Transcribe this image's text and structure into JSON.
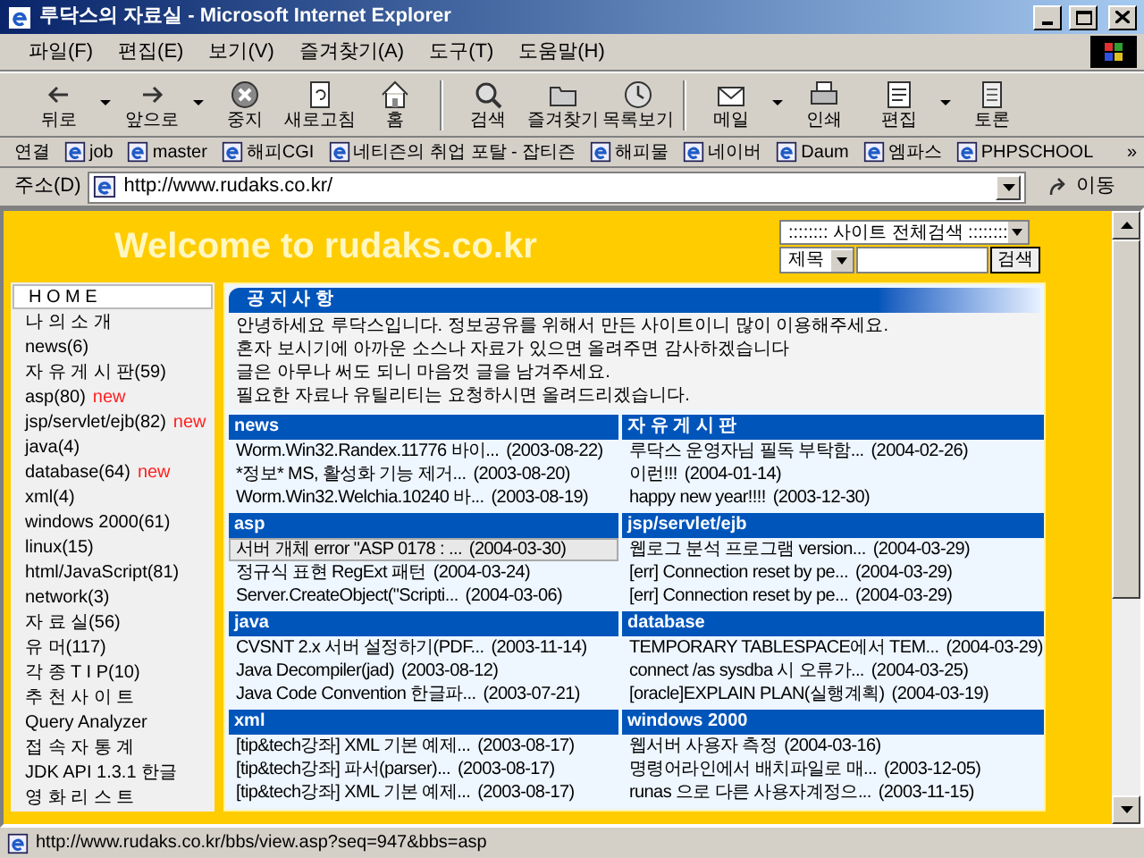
{
  "window": {
    "title": "루닥스의 자료실 - Microsoft Internet Explorer"
  },
  "menu": [
    "파일(F)",
    "편집(E)",
    "보기(V)",
    "즐겨찾기(A)",
    "도구(T)",
    "도움말(H)"
  ],
  "toolbar": [
    {
      "label": "뒤로",
      "dropdown": true
    },
    {
      "label": "앞으로",
      "dropdown": true
    },
    {
      "label": "중지",
      "dropdown": false
    },
    {
      "label": "새로고침",
      "dropdown": false
    },
    {
      "label": "홈",
      "dropdown": false
    },
    {
      "label": "검색",
      "dropdown": false
    },
    {
      "label": "즐겨찾기",
      "dropdown": false
    },
    {
      "label": "목록보기",
      "dropdown": false
    },
    {
      "label": "메일",
      "dropdown": true
    },
    {
      "label": "인쇄",
      "dropdown": false
    },
    {
      "label": "편집",
      "dropdown": true
    },
    {
      "label": "토론",
      "dropdown": false
    }
  ],
  "links_bar": {
    "label": "연결",
    "items": [
      "job",
      "master",
      "해피CGI",
      "네티즌의 취업 포탈 - 잡티즌",
      "해피물",
      "네이버",
      "Daum",
      "엠파스",
      "PHPSCHOOL"
    ],
    "more": "»"
  },
  "address_bar": {
    "label": "주소(D)",
    "url": "http://www.rudaks.co.kr/",
    "go": "이동"
  },
  "page": {
    "site_title": "Welcome to rudaks.co.kr",
    "search": {
      "scope": ":::::::: 사이트 전체검색 ::::::::",
      "field": "제목",
      "button": "검색"
    },
    "sidebar": [
      {
        "label": "H O M E",
        "selected": true
      },
      {
        "label": "나 의 소 개",
        "selected": false
      },
      {
        "label": "news(6)",
        "selected": false
      },
      {
        "label": "자 유 게 시 판(59)",
        "selected": false
      },
      {
        "label": "asp(80)",
        "badge": "new",
        "selected": false
      },
      {
        "label": "jsp/servlet/ejb(82)",
        "badge": "new",
        "selected": false
      },
      {
        "label": "java(4)",
        "selected": false
      },
      {
        "label": "database(64)",
        "badge": "new",
        "selected": false
      },
      {
        "label": "xml(4)",
        "selected": false
      },
      {
        "label": "windows 2000(61)",
        "selected": false
      },
      {
        "label": "linux(15)",
        "selected": false
      },
      {
        "label": "html/JavaScript(81)",
        "selected": false
      },
      {
        "label": "network(3)",
        "selected": false
      },
      {
        "label": "자 료 실(56)",
        "selected": false
      },
      {
        "label": "유 머(117)",
        "selected": false
      },
      {
        "label": "각 종 T I P(10)",
        "selected": false
      },
      {
        "label": "추 천 사 이 트",
        "selected": false
      },
      {
        "label": "Query Analyzer",
        "selected": false
      },
      {
        "label": "접 속 자 통 계",
        "selected": false
      },
      {
        "label": "JDK API 1.3.1 한글",
        "selected": false
      },
      {
        "label": "영 화 리 스 트",
        "selected": false
      }
    ],
    "notice": {
      "title": "공 지 사 항",
      "lines": [
        "안녕하세요 루닥스입니다. 정보공유를 위해서 만든 사이트이니 많이 이용해주세요.",
        "혼자 보시기에 아까운 소스나 자료가 있으면 올려주면 감사하겠습니다",
        "글은 아무나 써도 되니 마음껏 글을 남겨주세요.",
        "필요한 자료나 유틸리티는 요청하시면 올려드리겠습니다."
      ]
    },
    "boards": [
      {
        "title": "news",
        "posts": [
          {
            "title": "Worm.Win32.Randex.11776 바이...",
            "date": "(2003-08-22)",
            "hovered": false
          },
          {
            "title": "*정보* MS, 활성화 기능 제거...",
            "date": "(2003-08-20)",
            "hovered": false
          },
          {
            "title": "Worm.Win32.Welchia.10240 바...",
            "date": "(2003-08-19)",
            "hovered": false
          }
        ]
      },
      {
        "title": "자 유 게 시 판",
        "posts": [
          {
            "title": "루닥스 운영자님 필독 부탁함...",
            "date": "(2004-02-26)",
            "hovered": false
          },
          {
            "title": "이런!!!",
            "date": "(2004-01-14)",
            "hovered": false
          },
          {
            "title": "happy new year!!!!",
            "date": "(2003-12-30)",
            "hovered": false
          }
        ]
      },
      {
        "title": "asp",
        "posts": [
          {
            "title": "서버 개체 error \"ASP 0178 : ...",
            "date": "(2004-03-30)",
            "hovered": true
          },
          {
            "title": "정규식 표현 RegExt 패턴",
            "date": "(2004-03-24)",
            "hovered": false
          },
          {
            "title": "Server.CreateObject(\"Scripti...",
            "date": "(2004-03-06)",
            "hovered": false
          }
        ]
      },
      {
        "title": "jsp/servlet/ejb",
        "posts": [
          {
            "title": "웹로그 분석 프로그램 version...",
            "date": "(2004-03-29)",
            "hovered": false
          },
          {
            "title": "[err] Connection reset by pe...",
            "date": "(2004-03-29)",
            "hovered": false
          },
          {
            "title": "[err] Connection reset by pe...",
            "date": "(2004-03-29)",
            "hovered": false
          }
        ]
      },
      {
        "title": "java",
        "posts": [
          {
            "title": "CVSNT 2.x 서버 설정하기(PDF...",
            "date": "(2003-11-14)",
            "hovered": false
          },
          {
            "title": "Java Decompiler(jad)",
            "date": "(2003-08-12)",
            "hovered": false
          },
          {
            "title": "Java Code Convention 한글파...",
            "date": "(2003-07-21)",
            "hovered": false
          }
        ]
      },
      {
        "title": "database",
        "posts": [
          {
            "title": "TEMPORARY TABLESPACE에서 TEM...",
            "date": "(2004-03-29)",
            "hovered": false
          },
          {
            "title": "connect /as sysdba 시 오류가...",
            "date": "(2004-03-25)",
            "hovered": false
          },
          {
            "title": "[oracle]EXPLAIN PLAN(실행계획)",
            "date": "(2004-03-19)",
            "hovered": false
          }
        ]
      },
      {
        "title": "xml",
        "posts": [
          {
            "title": "[tip&tech강좌] XML 기본 예제...",
            "date": "(2003-08-17)",
            "hovered": false
          },
          {
            "title": "[tip&tech강좌] 파서(parser)...",
            "date": "(2003-08-17)",
            "hovered": false
          },
          {
            "title": "[tip&tech강좌] XML 기본 예제...",
            "date": "(2003-08-17)",
            "hovered": false
          }
        ]
      },
      {
        "title": "windows 2000",
        "posts": [
          {
            "title": "웹서버 사용자 측정",
            "date": "(2004-03-16)",
            "hovered": false
          },
          {
            "title": "명령어라인에서 배치파일로 매...",
            "date": "(2003-12-05)",
            "hovered": false
          },
          {
            "title": "runas 으로 다른 사용자계정으...",
            "date": "(2003-11-15)",
            "hovered": false
          }
        ]
      }
    ]
  },
  "status_bar": {
    "text": "http://www.rudaks.co.kr/bbs/view.asp?seq=947&bbs=asp"
  }
}
